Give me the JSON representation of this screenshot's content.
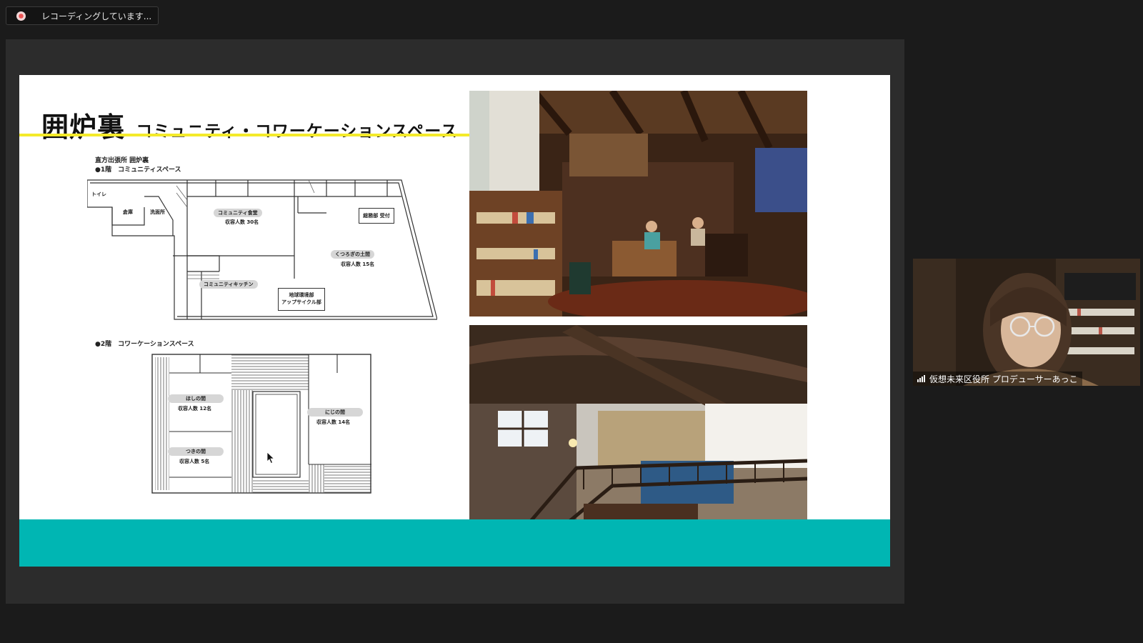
{
  "recording": {
    "label": "レコーディングしています...",
    "dot_color": "#e55555"
  },
  "slide": {
    "title_main": "囲炉裏",
    "title_sub": "コミュニティ・コワーケーションスペース",
    "accent_yellow": "#f4ea2a",
    "accent_teal": "#00b6b3",
    "plan_heading": "直方出張所 囲炉裏",
    "floor1_label": "●1階　コミュニティスペース",
    "floor2_label": "●2階　コワーケーションスペース",
    "rooms1": {
      "toilet": "トイレ",
      "storage": "倉庫",
      "washroom": "洗面所",
      "dining": "コミュニティ食堂",
      "dining_cap": "収容人数 30名",
      "reception": "総務部 受付",
      "doma": "くつろぎの土間",
      "doma_cap": "収容人数 15名",
      "kitchen": "コミュニティキッチン",
      "upcycle_a": "地球環境部",
      "upcycle_b": "アップサイクル部"
    },
    "rooms2": {
      "hoshi": "ほしの間",
      "hoshi_cap": "収容人数 12名",
      "tsuki": "つきの間",
      "tsuki_cap": "収容人数 5名",
      "niji": "にじの間",
      "niji_cap": "収容人数 14名"
    }
  },
  "participant": {
    "name": "仮想未来区役所 プロデューサーあっこ"
  }
}
